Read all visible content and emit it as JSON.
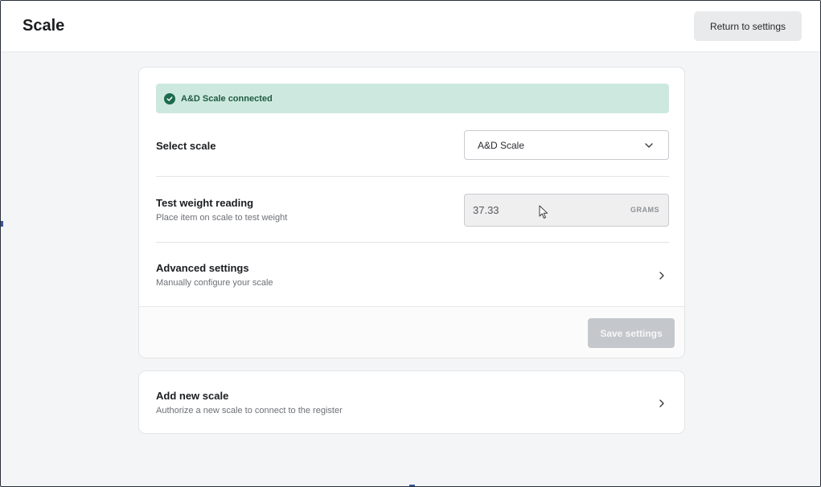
{
  "header": {
    "title": "Scale",
    "return_label": "Return to settings"
  },
  "status": {
    "message": "A&D Scale connected",
    "color": "#cde9df",
    "icon": "check-circle-icon"
  },
  "select_scale": {
    "label": "Select scale",
    "value": "A&D Scale"
  },
  "test_weight": {
    "label": "Test weight reading",
    "description": "Place item on scale to test weight",
    "value": "37.33",
    "unit": "GRAMS"
  },
  "advanced": {
    "label": "Advanced settings",
    "description": "Manually configure your scale"
  },
  "actions": {
    "save_label": "Save settings"
  },
  "add_scale": {
    "label": "Add new scale",
    "description": "Authorize a new scale to connect to the register"
  }
}
